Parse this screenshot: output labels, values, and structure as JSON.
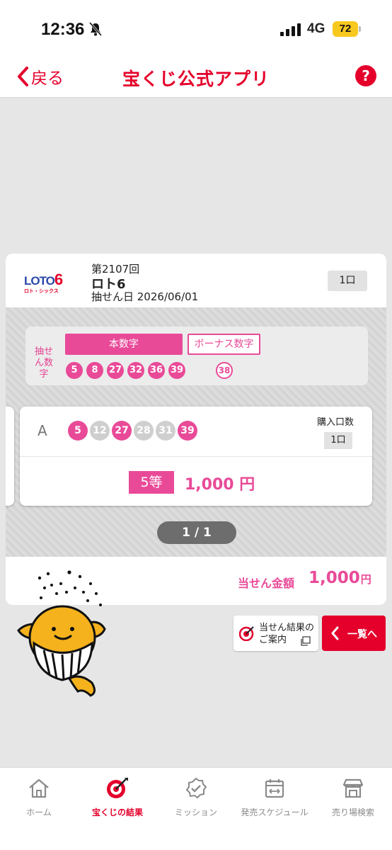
{
  "status_bar": {
    "time": "12:36",
    "network": "4G",
    "battery": "72"
  },
  "header": {
    "back_label": "戻る",
    "title": "宝くじ公式アプリ",
    "help_label": "?"
  },
  "result_card": {
    "logo_main": "LOTO",
    "logo_number": "6",
    "logo_sub": "ロト・シックス",
    "draw_number": "第2107回",
    "game_name": "ロト6",
    "draw_date": "抽せん日 2026/06/01",
    "units_badge": "1口",
    "winning": {
      "label": "抽せん数字",
      "main_label": "本数字",
      "bonus_label": "ボーナス数字",
      "main_numbers": [
        "5",
        "8",
        "27",
        "32",
        "36",
        "39"
      ],
      "bonus_number": "38"
    },
    "ticket": {
      "id": "A",
      "numbers": [
        {
          "value": "5",
          "hit": true
        },
        {
          "value": "12",
          "hit": false
        },
        {
          "value": "27",
          "hit": true
        },
        {
          "value": "28",
          "hit": false
        },
        {
          "value": "31",
          "hit": false
        },
        {
          "value": "39",
          "hit": true
        }
      ],
      "purchase_label": "購入口数",
      "purchase_units": "1口",
      "prize_rank": "5等",
      "prize_amount": "1,000 円"
    },
    "pager": "1 / 1",
    "total_label": "当せん金額",
    "total_value": "1,000",
    "total_unit": "円"
  },
  "guide_button": {
    "line1": "当せん結果の",
    "line2": "ご案内"
  },
  "list_button": {
    "label": "一覧へ"
  },
  "bottom_nav": [
    {
      "label": "ホーム",
      "icon": "home-icon",
      "active": false
    },
    {
      "label": "宝くじの結果",
      "icon": "target-icon",
      "active": true
    },
    {
      "label": "ミッション",
      "icon": "check-badge-icon",
      "active": false
    },
    {
      "label": "発売スケジュール",
      "icon": "calendar-icon",
      "active": false
    },
    {
      "label": "売り場検索",
      "icon": "shop-icon",
      "active": false
    }
  ],
  "colors": {
    "brand_red": "#e4002b",
    "pink": "#e94a98",
    "miss_gray": "#cfcfcf"
  }
}
